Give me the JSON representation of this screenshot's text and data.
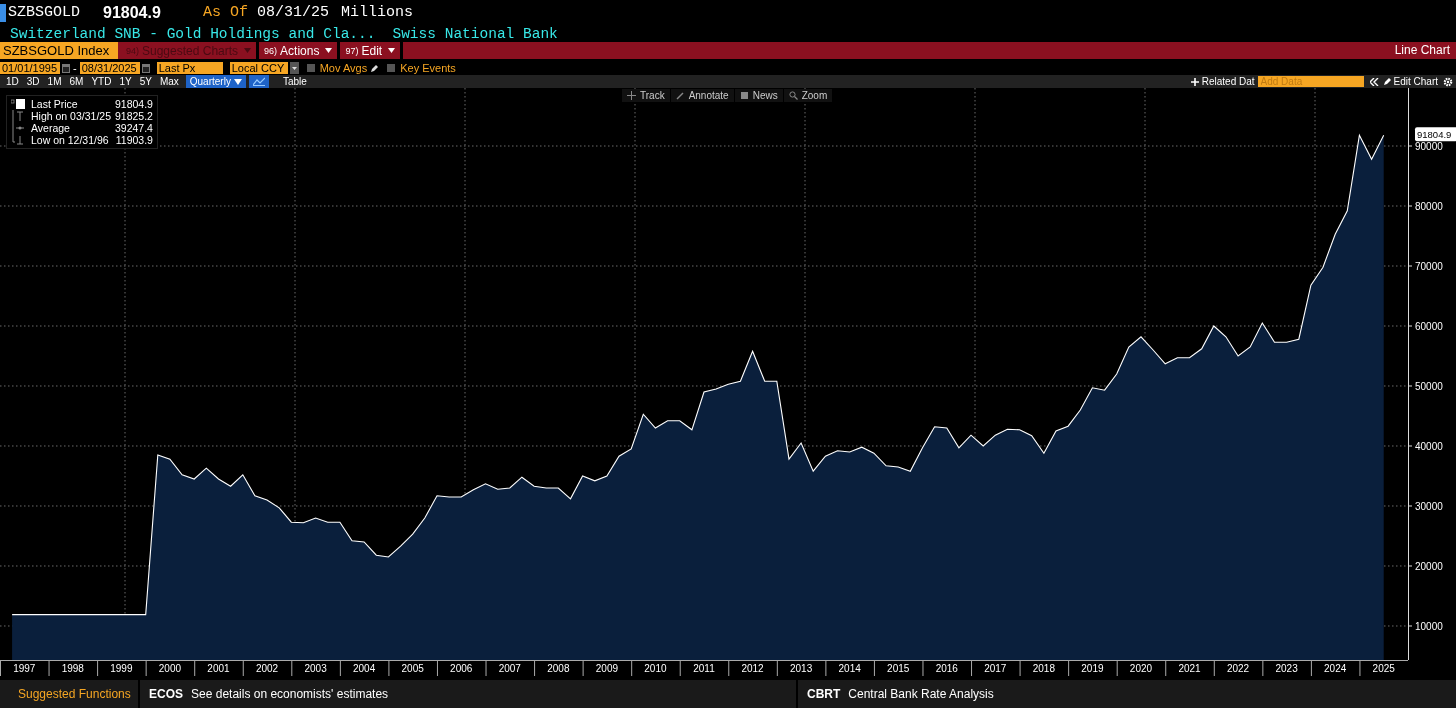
{
  "header": {
    "ticker": "SZBSGOLD",
    "last": "91804.9",
    "as_of_label": "As Of",
    "as_of_date": "08/31/25",
    "units": "Millions"
  },
  "subtitle": {
    "name": "Switzerland SNB - Gold Holdings and Cla...",
    "source": "Swiss National Bank"
  },
  "command_bar": {
    "security": "SZBSGOLD Index",
    "menus": [
      {
        "number": "94)",
        "label": "Suggested Charts",
        "disabled": true
      },
      {
        "number": "96)",
        "label": "Actions",
        "disabled": false
      },
      {
        "number": "97)",
        "label": "Edit",
        "disabled": false
      }
    ],
    "title": "Line Chart"
  },
  "range": {
    "start": "01/01/1995",
    "separator": "-",
    "end": "08/31/2025",
    "field": "Last Px",
    "currency": "Local CCY",
    "options": [
      {
        "label": "Mov Avgs",
        "checked": false
      },
      {
        "label": "Key Events",
        "checked": false
      }
    ]
  },
  "periods": [
    {
      "label": "1D",
      "selected": false
    },
    {
      "label": "3D",
      "selected": false
    },
    {
      "label": "1M",
      "selected": false
    },
    {
      "label": "6M",
      "selected": false
    },
    {
      "label": "YTD",
      "selected": false
    },
    {
      "label": "1Y",
      "selected": false
    },
    {
      "label": "5Y",
      "selected": false
    },
    {
      "label": "Max",
      "selected": false
    }
  ],
  "frequency": "Quarterly",
  "table_button": "Table",
  "right_tools": {
    "related": "Related Dat",
    "add_data_placeholder": "Add Data",
    "edit": "Edit Chart"
  },
  "chart_tools": [
    "Track",
    "Annotate",
    "News",
    "Zoom"
  ],
  "legend": [
    {
      "kind": "last",
      "value": "91804.9"
    },
    {
      "kind": "high",
      "label": "High on 03/31/25",
      "value": "91825.2"
    },
    {
      "kind": "average",
      "label": "Average",
      "value": "39247.4"
    },
    {
      "kind": "low",
      "label": "Low on 12/31/96",
      "value": "11903.9"
    }
  ],
  "chart": {
    "last_label": "91804.9",
    "chart_data": {
      "type": "area",
      "x": [
        1997.25,
        1997.5,
        1997.75,
        1998,
        1998.25,
        1998.5,
        1998.75,
        1999,
        1999.25,
        1999.5,
        1999.75,
        2000,
        2000.25,
        2000.5,
        2000.75,
        2001,
        2001.25,
        2001.5,
        2001.75,
        2002,
        2002.25,
        2002.5,
        2002.75,
        2003,
        2003.25,
        2003.5,
        2003.75,
        2004,
        2004.25,
        2004.5,
        2004.75,
        2005,
        2005.25,
        2005.5,
        2005.75,
        2006,
        2006.25,
        2006.5,
        2006.75,
        2007,
        2007.25,
        2007.5,
        2007.75,
        2008,
        2008.25,
        2008.5,
        2008.75,
        2009,
        2009.25,
        2009.5,
        2009.75,
        2010,
        2010.25,
        2010.5,
        2010.75,
        2011,
        2011.25,
        2011.5,
        2011.75,
        2012,
        2012.25,
        2012.5,
        2012.75,
        2013,
        2013.25,
        2013.5,
        2013.75,
        2014,
        2014.25,
        2014.5,
        2014.75,
        2015,
        2015.25,
        2015.5,
        2015.75,
        2016,
        2016.25,
        2016.5,
        2016.75,
        2017,
        2017.25,
        2017.5,
        2017.75,
        2018,
        2018.25,
        2018.5,
        2018.75,
        2019,
        2019.25,
        2019.5,
        2019.75,
        2020,
        2020.25,
        2020.5,
        2020.75,
        2021,
        2021.25,
        2021.5,
        2021.75,
        2022,
        2022.25,
        2022.5,
        2022.75,
        2023,
        2023.25,
        2023.5,
        2023.75,
        2024,
        2024.25,
        2024.5,
        2024.75,
        2025,
        2025.25,
        2025.5
      ],
      "series": [
        {
          "name": "Last Price",
          "color": "#ffffff",
          "values": [
            11900,
            11900,
            11900,
            11900,
            11900,
            11900,
            11900,
            11900,
            11900,
            11900,
            11900,
            11900,
            38500,
            37800,
            35200,
            34500,
            36300,
            34500,
            33300,
            35200,
            31700,
            31000,
            29700,
            27300,
            27200,
            28000,
            27300,
            27300,
            24200,
            24000,
            21800,
            21500,
            23300,
            25300,
            28000,
            31700,
            31500,
            31500,
            32700,
            33700,
            32800,
            33000,
            34800,
            33300,
            33000,
            33000,
            31200,
            35000,
            34200,
            35000,
            38300,
            39500,
            45300,
            43000,
            44200,
            44200,
            42700,
            49000,
            49500,
            50300,
            50800,
            55800,
            50800,
            50800,
            37800,
            40500,
            35800,
            38300,
            39200,
            39000,
            39800,
            38800,
            36700,
            36500,
            35800,
            39700,
            43200,
            43000,
            39700,
            41800,
            40000,
            41800,
            42800,
            42700,
            41700,
            38800,
            42500,
            43300,
            46000,
            49700,
            49300,
            52000,
            56500,
            58200,
            56000,
            53700,
            54700,
            54700,
            56200,
            60000,
            58200,
            55000,
            56500,
            60500,
            57300,
            57300,
            57800,
            66800,
            69800,
            75300,
            79200,
            91800,
            87800,
            91800
          ]
        }
      ],
      "grid": true,
      "xlim": [
        1997,
        2026
      ],
      "ylim": [
        4333,
        99667
      ],
      "xticks": [
        {
          "value": 1997.5,
          "label": "1997"
        },
        {
          "value": 1998.5,
          "label": "1998"
        },
        {
          "value": 1999.5,
          "label": "1999"
        },
        {
          "value": 2000.5,
          "label": "2000"
        },
        {
          "value": 2001.5,
          "label": "2001"
        },
        {
          "value": 2002.5,
          "label": "2002"
        },
        {
          "value": 2003.5,
          "label": "2003"
        },
        {
          "value": 2004.5,
          "label": "2004"
        },
        {
          "value": 2005.5,
          "label": "2005"
        },
        {
          "value": 2006.5,
          "label": "2006"
        },
        {
          "value": 2007.5,
          "label": "2007"
        },
        {
          "value": 2008.5,
          "label": "2008"
        },
        {
          "value": 2009.5,
          "label": "2009"
        },
        {
          "value": 2010.5,
          "label": "2010"
        },
        {
          "value": 2011.5,
          "label": "2011"
        },
        {
          "value": 2012.5,
          "label": "2012"
        },
        {
          "value": 2013.5,
          "label": "2013"
        },
        {
          "value": 2014.5,
          "label": "2014"
        },
        {
          "value": 2015.5,
          "label": "2015"
        },
        {
          "value": 2016.5,
          "label": "2016"
        },
        {
          "value": 2017.5,
          "label": "2017"
        },
        {
          "value": 2018.5,
          "label": "2018"
        },
        {
          "value": 2019.5,
          "label": "2019"
        },
        {
          "value": 2020.5,
          "label": "2020"
        },
        {
          "value": 2021.5,
          "label": "2021"
        },
        {
          "value": 2022.5,
          "label": "2022"
        },
        {
          "value": 2023.5,
          "label": "2023"
        },
        {
          "value": 2024.5,
          "label": "2024"
        },
        {
          "value": 2025.5,
          "label": "2025"
        }
      ],
      "yticks": [
        10000,
        20000,
        30000,
        40000,
        50000,
        60000,
        70000,
        80000,
        90000
      ]
    }
  },
  "footer": {
    "suggested": "Suggested Functions",
    "items": [
      {
        "code": "ECOS",
        "text": "See details on economists' estimates"
      },
      {
        "code": "CBRT",
        "text": "Central Bank Rate Analysis"
      }
    ]
  }
}
